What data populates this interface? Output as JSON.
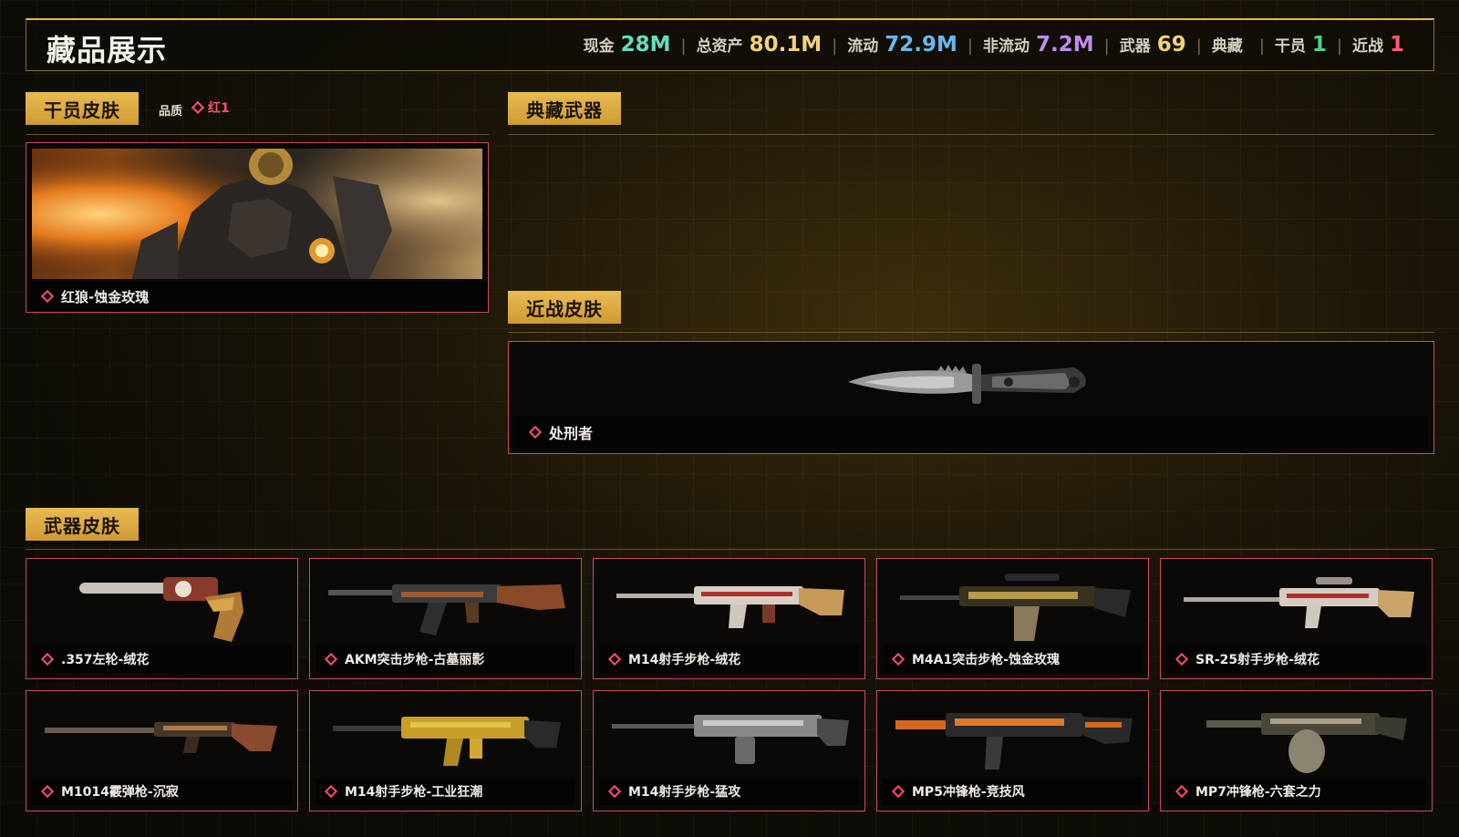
{
  "header": {
    "title": "藏品展示",
    "stats": [
      {
        "label": "现金",
        "value": "28M",
        "color": "#5fe0c0"
      },
      {
        "label": "总资产",
        "value": "80.1M",
        "color": "#f2d27a"
      },
      {
        "label": "流动",
        "value": "72.9M",
        "color": "#6ab8f0"
      },
      {
        "label": "非流动",
        "value": "7.2M",
        "color": "#c08cf0"
      },
      {
        "label": "武器",
        "value": "69",
        "color": "#f2d27a"
      },
      {
        "label": "典藏",
        "value": "",
        "color": "#f2d27a"
      },
      {
        "label": "干员",
        "value": "1",
        "color": "#48d680"
      },
      {
        "label": "近战",
        "value": "1",
        "color": "#ff5a78"
      }
    ]
  },
  "operator_section": {
    "label": "干员皮肤",
    "quality_label": "品质",
    "quality_value": "红1",
    "card": {
      "name": "红狼-蚀金玫瑰"
    }
  },
  "collection_section": {
    "label": "典藏武器"
  },
  "melee_section": {
    "label": "近战皮肤",
    "card": {
      "name": "处刑者"
    }
  },
  "weapon_section": {
    "label": "武器皮肤",
    "items": [
      {
        "name": ".357左轮-绒花"
      },
      {
        "name": "AKM突击步枪-古墓丽影"
      },
      {
        "name": "M14射手步枪-绒花"
      },
      {
        "name": "M4A1突击步枪-蚀金玫瑰"
      },
      {
        "name": "SR-25射手步枪-绒花"
      },
      {
        "name": "M1014霰弹枪-沉寂"
      },
      {
        "name": "M14射手步枪-工业狂潮"
      },
      {
        "name": "M14射手步枪-猛攻"
      },
      {
        "name": "MP5冲锋枪-竞技风"
      },
      {
        "name": "MP7冲锋枪-六套之力"
      }
    ]
  },
  "colors": {
    "accent_gold": "#e6b84c",
    "rarity_red": "#ff4d6d",
    "card_border": "#c84c63"
  }
}
